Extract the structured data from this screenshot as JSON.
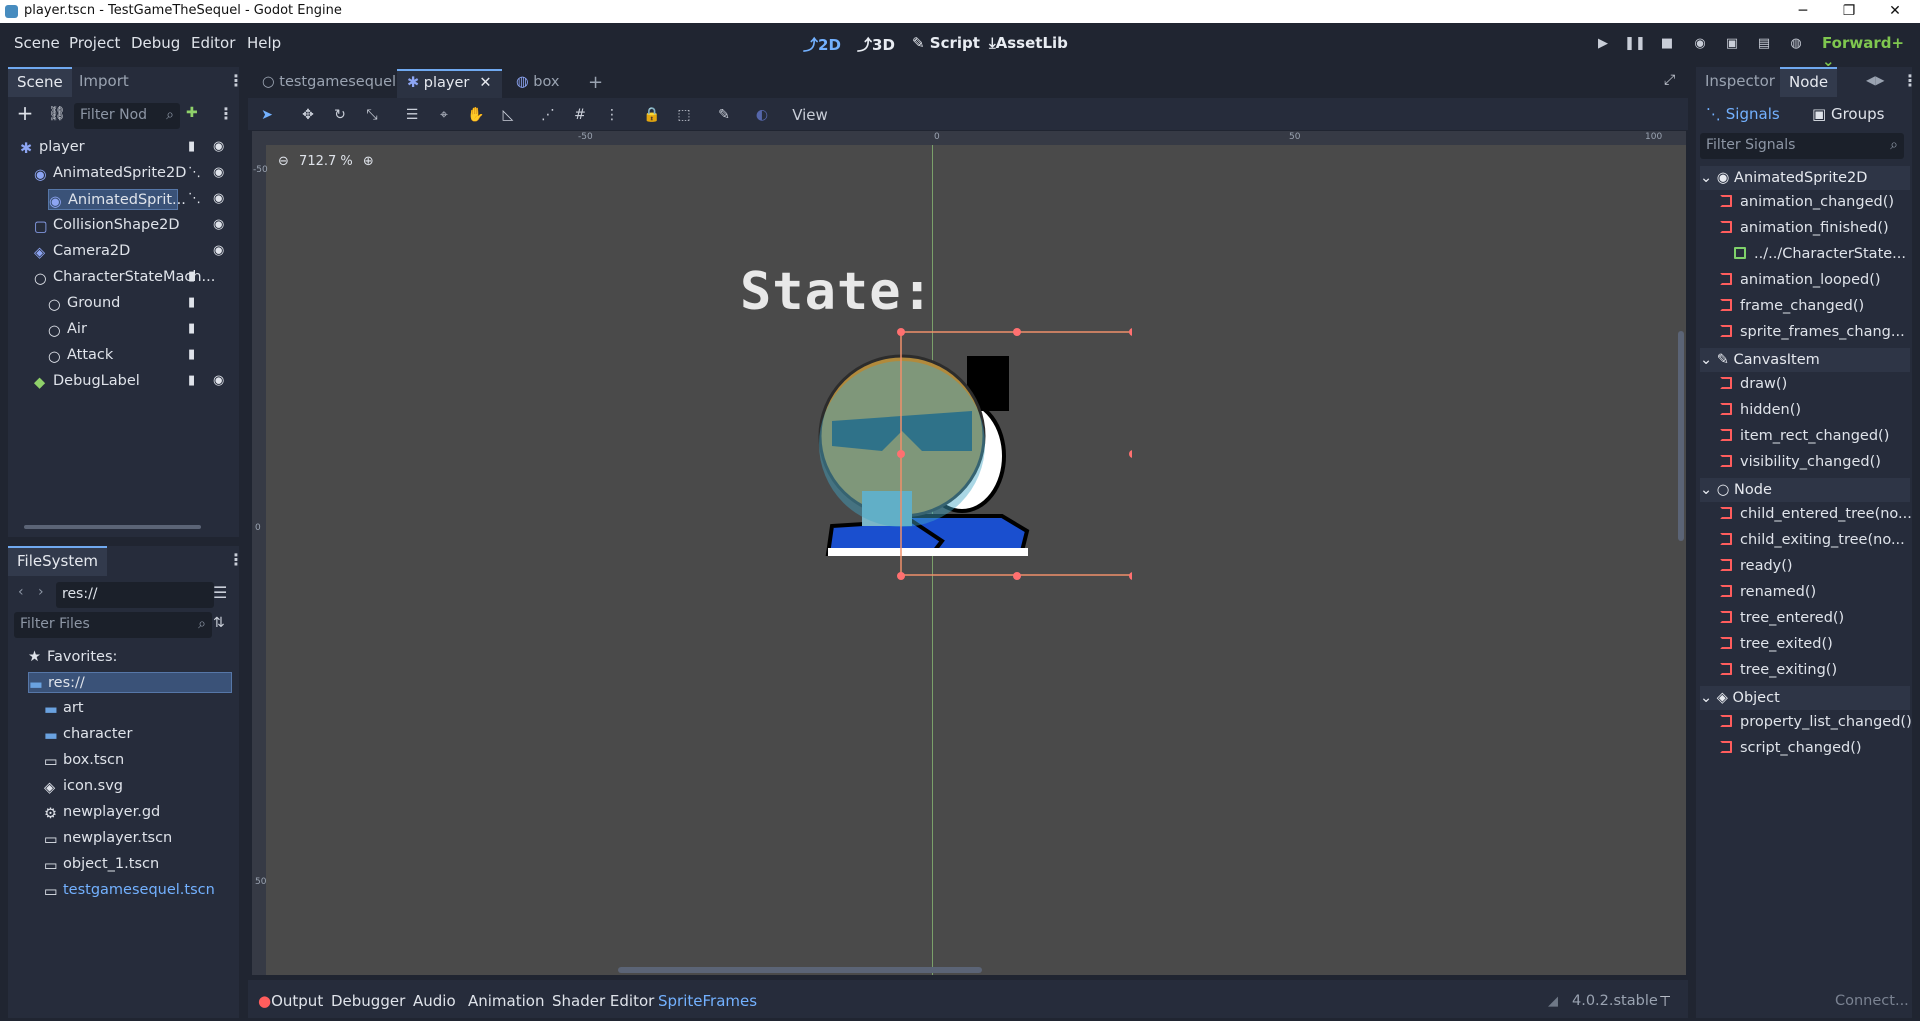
{
  "window": {
    "title": "player.tscn - TestGameTheSequel - Godot Engine",
    "minimize": "─",
    "maximize": "❐",
    "close": "✕"
  },
  "menu": {
    "items": [
      "Scene",
      "Project",
      "Debug",
      "Editor",
      "Help"
    ]
  },
  "workspace": {
    "modes": [
      "2D",
      "3D",
      "Script",
      "AssetLib"
    ],
    "active": "2D",
    "renderer": "Forward+"
  },
  "scene_dock": {
    "tabs": [
      "Scene",
      "Import"
    ],
    "filter_placeholder": "Filter Nod",
    "tree": [
      {
        "label": "player",
        "icon": "player-node-icon"
      },
      {
        "label": "AnimatedSprite2D",
        "icon": "animated-sprite-icon"
      },
      {
        "label": "AnimatedSprit...",
        "icon": "animated-sprite-icon",
        "selected": true
      },
      {
        "label": "CollisionShape2D",
        "icon": "collision-shape-icon"
      },
      {
        "label": "Camera2D",
        "icon": "camera-icon"
      },
      {
        "label": "CharacterStateMach...",
        "icon": "node-circle-icon"
      },
      {
        "label": "Ground",
        "icon": "node-circle-icon"
      },
      {
        "label": "Air",
        "icon": "node-circle-icon"
      },
      {
        "label": "Attack",
        "icon": "node-circle-icon"
      },
      {
        "label": "DebugLabel",
        "icon": "label-icon"
      }
    ]
  },
  "filesystem": {
    "tab": "FileSystem",
    "path": "res://",
    "filter_placeholder": "Filter Files",
    "favorites": "Favorites:",
    "items": [
      {
        "label": "res://",
        "type": "folder",
        "selected": true
      },
      {
        "label": "art",
        "type": "folder"
      },
      {
        "label": "character",
        "type": "folder"
      },
      {
        "label": "box.tscn",
        "type": "scene"
      },
      {
        "label": "icon.svg",
        "type": "image"
      },
      {
        "label": "newplayer.gd",
        "type": "script"
      },
      {
        "label": "newplayer.tscn",
        "type": "scene"
      },
      {
        "label": "object_1.tscn",
        "type": "scene"
      },
      {
        "label": "testgamesequel.tscn",
        "type": "scene",
        "highlight": true
      }
    ]
  },
  "scene_tabs": {
    "tabs": [
      "testgamesequel",
      "player",
      "box"
    ],
    "active": "player",
    "add": "+"
  },
  "toolbar": {
    "view": "View"
  },
  "viewport": {
    "zoom": "712.7 %",
    "state_label": "State:",
    "ruler_top": [
      "-50",
      "0",
      "50",
      "100"
    ],
    "ruler_left": [
      "-50",
      "0",
      "50"
    ]
  },
  "inspector": {
    "tabs": [
      "Inspector",
      "Node"
    ],
    "active": "Node",
    "subtabs": [
      "Signals",
      "Groups"
    ],
    "filter_placeholder": "Filter Signals",
    "sections": [
      {
        "name": "AnimatedSprite2D",
        "signals": [
          "animation_changed()",
          "animation_finished()",
          "../../CharacterState...",
          "animation_looped()",
          "frame_changed()",
          "sprite_frames_chang..."
        ]
      },
      {
        "name": "CanvasItem",
        "signals": [
          "draw()",
          "hidden()",
          "item_rect_changed()",
          "visibility_changed()"
        ]
      },
      {
        "name": "Node",
        "signals": [
          "child_entered_tree(no...",
          "child_exiting_tree(no...",
          "ready()",
          "renamed()",
          "tree_entered()",
          "tree_exited()",
          "tree_exiting()"
        ]
      },
      {
        "name": "Object",
        "signals": [
          "property_list_changed()",
          "script_changed()"
        ]
      }
    ]
  },
  "bottom": {
    "tabs": [
      "Output",
      "Debugger",
      "Audio",
      "Animation",
      "Shader Editor",
      "SpriteFrames"
    ],
    "active": "SpriteFrames",
    "version": "4.0.2.stable",
    "connect": "Connect..."
  },
  "colors": {
    "accent": "#70a9f0",
    "signal": "#ff5d5d",
    "background": "#202531",
    "panel": "#262c3b",
    "viewport": "#4a4a4a"
  }
}
